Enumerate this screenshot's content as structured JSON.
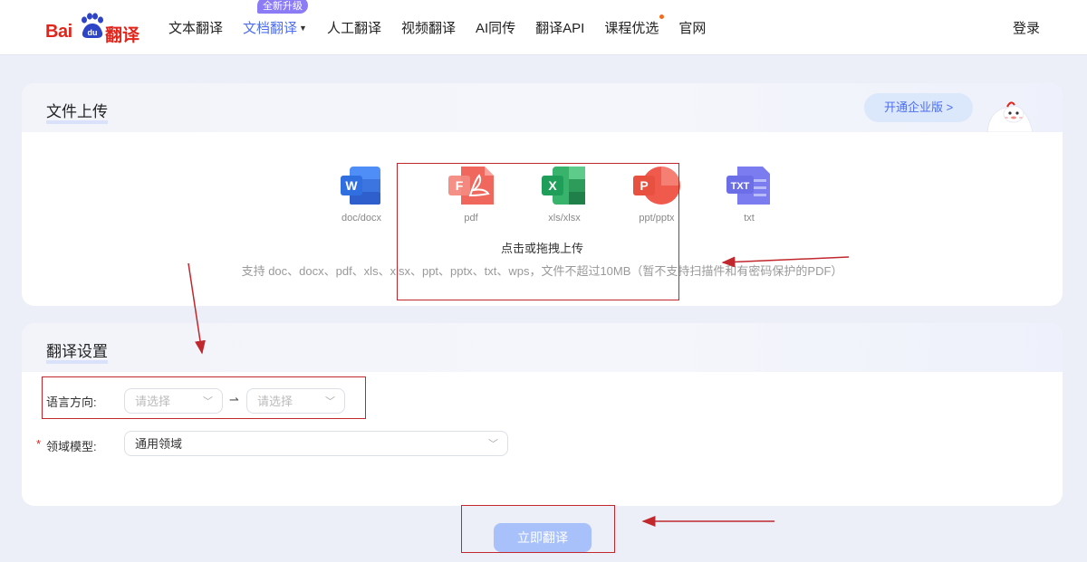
{
  "nav": {
    "logo_text_left": "Bai",
    "logo_text_paw": "du",
    "logo_text_right": "翻译",
    "items": [
      {
        "label": "文本翻译"
      },
      {
        "label": "文档翻译",
        "badge": "全新升级",
        "active": true
      },
      {
        "label": "人工翻译"
      },
      {
        "label": "视频翻译"
      },
      {
        "label": "AI同传"
      },
      {
        "label": "翻译API"
      },
      {
        "label": "课程优选",
        "dot": true
      },
      {
        "label": "官网"
      }
    ],
    "login": "登录"
  },
  "upload_card": {
    "title": "文件上传",
    "enterprise_button": "开通企业版 >",
    "file_types": [
      {
        "label": "doc/docx",
        "icon": "word-icon",
        "letter": "W",
        "color": "#2f6fe0"
      },
      {
        "label": "pdf",
        "icon": "pdf-icon",
        "letter": "F",
        "color": "#e84a3c"
      },
      {
        "label": "xls/xlsx",
        "icon": "excel-icon",
        "letter": "X",
        "color": "#1f9e5a"
      },
      {
        "label": "ppt/pptx",
        "icon": "ppt-icon",
        "letter": "P",
        "color": "#e8503f"
      },
      {
        "label": "txt",
        "icon": "txt-icon",
        "letter": "TXT",
        "color": "#6c6ee8"
      }
    ],
    "upload_hint": "点击或拖拽上传",
    "support_text": "支持 doc、docx、pdf、xls、xlsx、ppt、pptx、txt、wps，文件不超过10MB（暂不支持扫描件和有密码保护的PDF）"
  },
  "settings_card": {
    "title": "翻译设置",
    "language_label": "语言方向:",
    "source_placeholder": "请选择",
    "target_placeholder": "请选择",
    "direction_arrow": "⇀",
    "domain_required_mark": "*",
    "domain_label": "领域模型:",
    "domain_value": "通用领域"
  },
  "translate_button": "立即翻译",
  "colors": {
    "brand_red": "#e1251b",
    "accent_blue": "#4e6ef2",
    "button_disabled": "#a9c1fb",
    "annotation_red": "#c0282d"
  }
}
